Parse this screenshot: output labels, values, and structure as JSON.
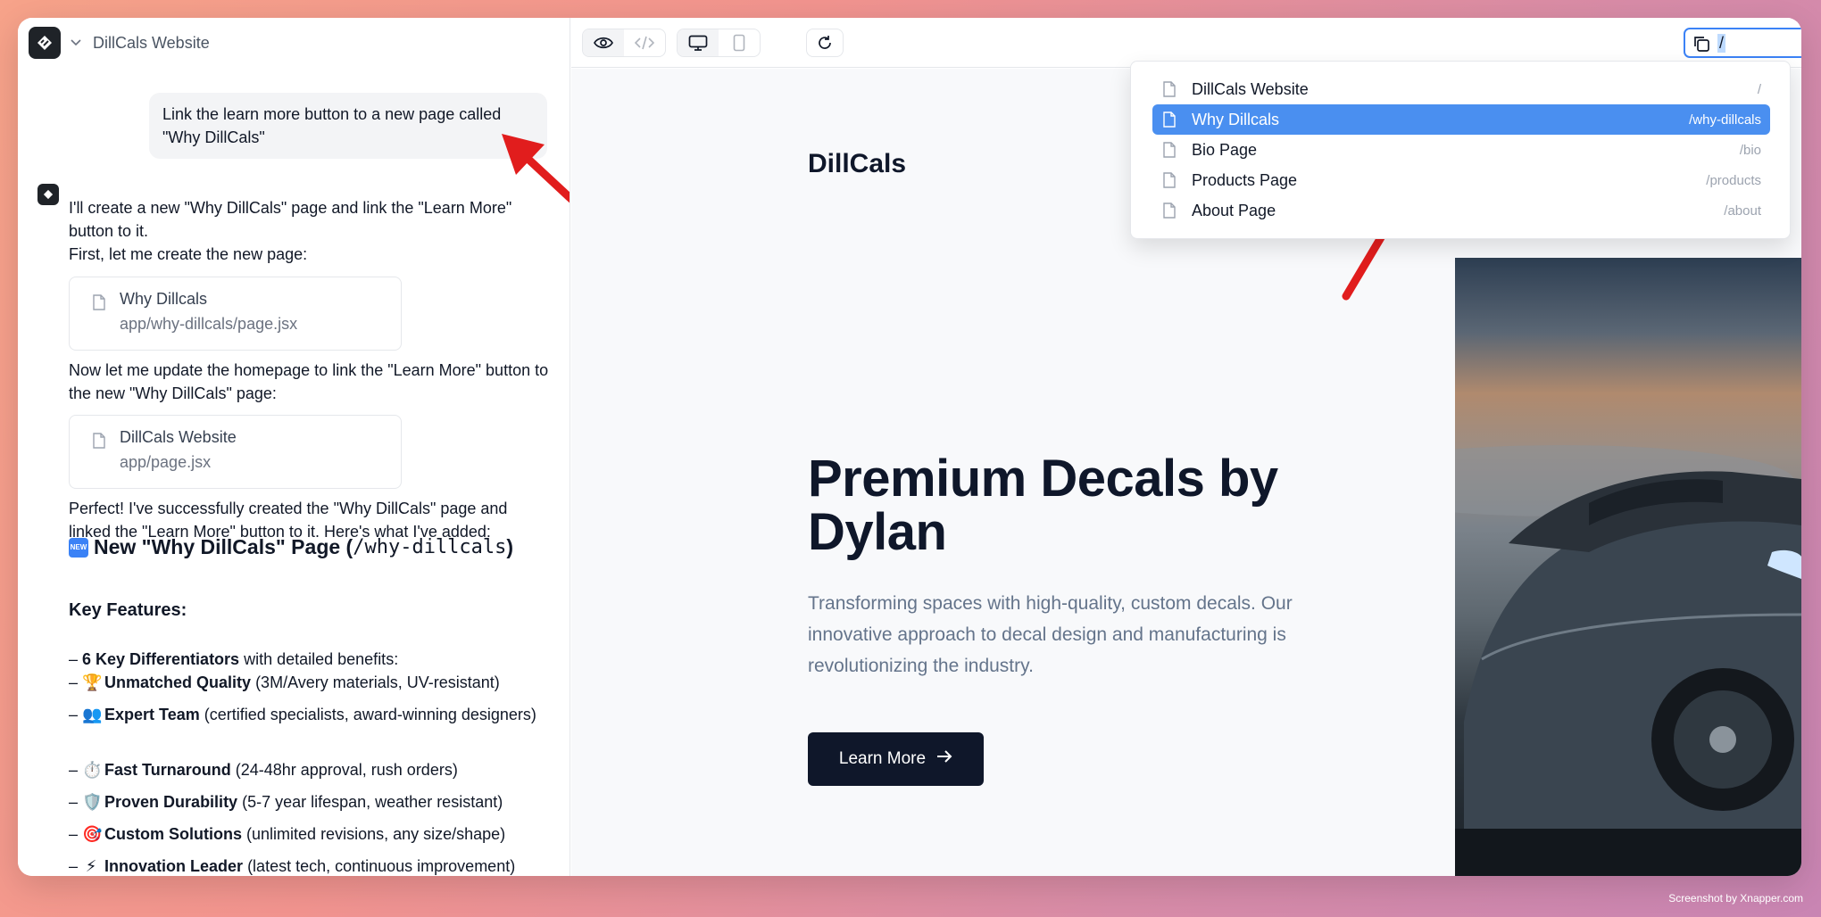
{
  "app": {
    "project_title": "DillCals Website"
  },
  "chat": {
    "user_message": "Link the learn more button to a new page called \"Why DillCals\"",
    "ai_intro_1": "I'll create a new \"Why DillCals\" page and link the \"Learn More\" button to it.",
    "ai_intro_2": "First, let me create the new page:",
    "file_card_1": {
      "name": "Why Dillcals",
      "path": "app/why-dillcals/page.jsx"
    },
    "ai_update": "Now let me update the homepage to link the \"Learn More\" button to the new \"Why DillCals\" page:",
    "file_card_2": {
      "name": "DillCals Website",
      "path": "app/page.jsx"
    },
    "ai_done": "Perfect! I've successfully created the \"Why DillCals\" page and linked the \"Learn More\" button to it. Here's what I've added:",
    "heading_prefix": "New \"Why DillCals\" Page (",
    "heading_code": "/why-dillcals",
    "heading_suffix": ")",
    "new_badge": "NEW",
    "key_features_heading": "Key Features:",
    "features": [
      {
        "emoji": "",
        "bold": "6 Key Differentiators",
        "rest": " with detailed benefits:"
      },
      {
        "emoji": "🏆",
        "bold": "Unmatched Quality",
        "rest": " (3M/Avery materials, UV-resistant)"
      },
      {
        "emoji": "👥",
        "bold": "Expert Team",
        "rest": " (certified specialists, award-winning designers)"
      },
      {
        "emoji": "⏱️",
        "bold": "Fast Turnaround",
        "rest": " (24-48hr approval, rush orders)"
      },
      {
        "emoji": "🛡️",
        "bold": "Proven Durability",
        "rest": " (5-7 year lifespan, weather resistant)"
      },
      {
        "emoji": "🎯",
        "bold": "Custom Solutions",
        "rest": " (unlimited revisions, any size/shape)"
      },
      {
        "emoji": "⚡",
        "bold": "Innovation Leader",
        "rest": " (latest tech, continuous improvement)"
      }
    ]
  },
  "url_bar": {
    "value": "/"
  },
  "dropdown": {
    "items": [
      {
        "label": "DillCals Website",
        "path": "/"
      },
      {
        "label": "Why Dillcals",
        "path": "/why-dillcals",
        "selected": true
      },
      {
        "label": "Bio Page",
        "path": "/bio"
      },
      {
        "label": "Products Page",
        "path": "/products"
      },
      {
        "label": "About Page",
        "path": "/about"
      }
    ]
  },
  "preview": {
    "brand": "DillCals",
    "hero_title": "Premium Decals by Dylan",
    "hero_desc": "Transforming spaces with high-quality, custom decals. Our innovative approach to decal design and manufacturing is revolutionizing the industry.",
    "cta_label": "Learn More"
  },
  "watermark": "Screenshot by Xnapper.com",
  "colors": {
    "accent": "#3b82f6",
    "selected_item": "#4a8ff0",
    "dark": "#0f172a",
    "arrow": "#e11d1d"
  },
  "icons": [
    "app-logo-icon",
    "chevron-down-icon",
    "file-icon",
    "eye-icon",
    "code-icon",
    "desktop-icon",
    "mobile-icon",
    "refresh-icon",
    "copy-icon",
    "external-link-icon",
    "arrow-right-icon"
  ]
}
